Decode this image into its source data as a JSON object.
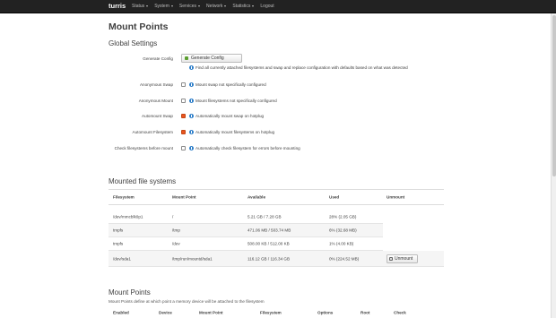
{
  "nav": {
    "brand": "turris",
    "items": [
      "Status",
      "System",
      "Services",
      "Network",
      "Statistics",
      "Logout"
    ]
  },
  "page_title": "Mount Points",
  "global_settings": {
    "title": "Global Settings",
    "generate_config_label": "Generate Config",
    "generate_button": "Generate Config",
    "generate_help": "Find all currently attached filesystems and swap and replace configuration with defaults based on what was detected",
    "options": [
      {
        "label": "Anonymous Swap",
        "checked": false,
        "help": "Mount swap not specifically configured"
      },
      {
        "label": "Anonymous Mount",
        "checked": false,
        "help": "Mount filesystems not specifically configured"
      },
      {
        "label": "Automount Swap",
        "checked": true,
        "help": "Automatically mount swap on hotplug"
      },
      {
        "label": "Automount Filesystem",
        "checked": true,
        "help": "Automatically mount filesystems on hotplug"
      },
      {
        "label": "Check filesystems before mount",
        "checked": false,
        "help": "Automatically check filesystem for errors before mounting"
      }
    ]
  },
  "mounted": {
    "title": "Mounted file systems",
    "headers": [
      "Filesystem",
      "Mount Point",
      "Available",
      "Used",
      "Unmount"
    ],
    "rows": [
      {
        "fs": "/dev/mmcblk0p1",
        "mount": "/",
        "available": "5.21 GB / 7.28 GB",
        "used": "28% (2.05 GB)",
        "unmount": ""
      },
      {
        "fs": "tmpfs",
        "mount": "/tmp",
        "available": "471.06 MB / 503.74 MB",
        "used": "6% (32.68 MB)",
        "unmount": ""
      },
      {
        "fs": "tmpfs",
        "mount": "/dev",
        "available": "508.00 KB / 512.00 KB",
        "used": "1% (4.00 KB)",
        "unmount": ""
      },
      {
        "fs": "/dev/sda1",
        "mount": "/tmp/run/mountd/sda1",
        "available": "116.12 GB / 116.34 GB",
        "used": "0% (224.52 MB)",
        "unmount": "Unmount"
      }
    ]
  },
  "mount_points": {
    "title": "Mount Points",
    "description": "Mount Points define at which point a memory device will be attached to the filesystem",
    "headers": [
      "Enabled",
      "Device",
      "Mount Point",
      "Filesystem",
      "Options",
      "Root",
      "Check"
    ]
  },
  "colors": {
    "navbar": "#222222",
    "accent": "#e95420",
    "info": "#2d7ec9"
  }
}
